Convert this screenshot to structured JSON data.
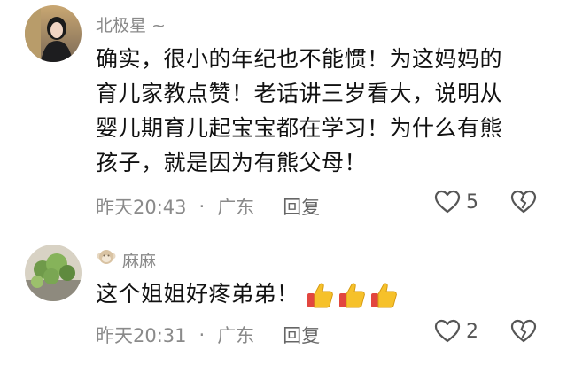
{
  "comments": [
    {
      "username": "北极星 ~",
      "lines": [
        "确实，很小的年纪也不能惯！为这妈妈的",
        "育儿家教点赞！老话讲三岁看大，说明从",
        "婴儿期育儿起宝宝都在学习！为什么有熊",
        "孩子，就是因为有熊父母！"
      ],
      "time": "昨天20:43",
      "dot": "·",
      "location": "广东",
      "reply_label": "回复",
      "likes": "5",
      "avatar_icon": "woman-portrait-avatar"
    },
    {
      "username": "麻麻",
      "badge_icon": "monkey-badge-icon",
      "text": "这个姐姐好疼弟弟！",
      "emoji": [
        "thumbs-up-emoji",
        "thumbs-up-emoji",
        "thumbs-up-emoji"
      ],
      "time": "昨天20:31",
      "dot": "·",
      "location": "广东",
      "reply_label": "回复",
      "likes": "2",
      "avatar_icon": "plant-photo-avatar"
    }
  ],
  "colors": {
    "meta_gray": "#8a8a8a",
    "emoji_yellow": "#f6c12a",
    "emoji_red": "#e2463f"
  }
}
